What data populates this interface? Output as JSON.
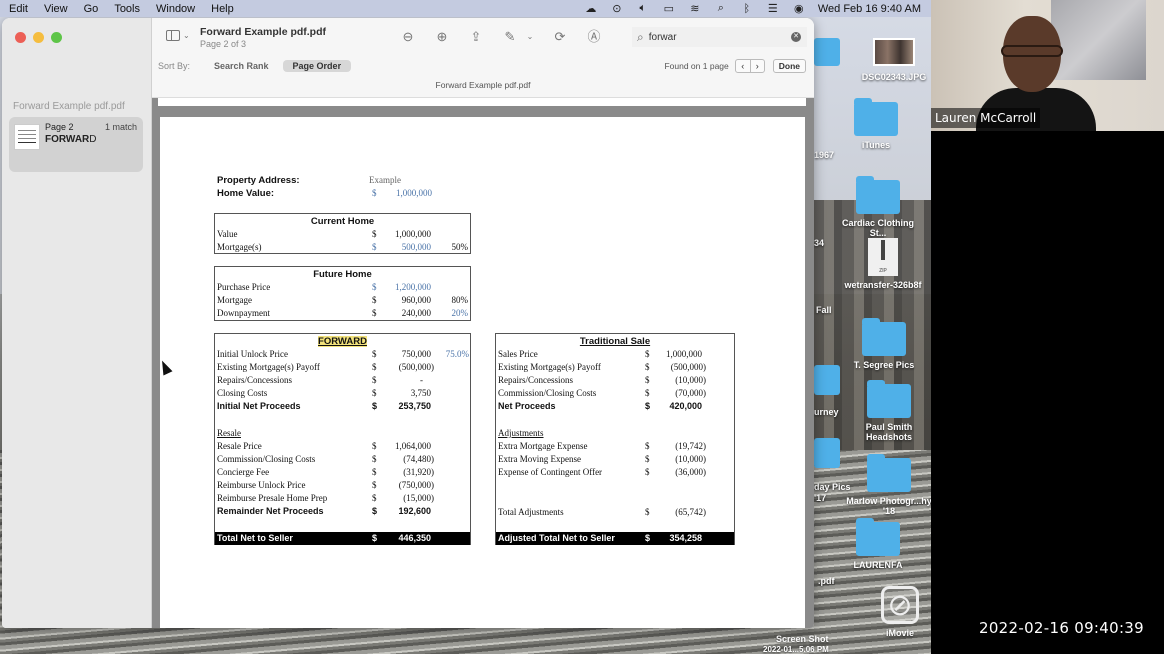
{
  "menubar": {
    "items": [
      "Edit",
      "View",
      "Go",
      "Tools",
      "Window",
      "Help"
    ],
    "status_icons": [
      "cloud-icon",
      "play-icon",
      "volume-icon",
      "battery-icon",
      "wifi-icon",
      "search-icon",
      "bluetooth-icon",
      "control-center-icon",
      "siri-icon"
    ],
    "clock": "Wed Feb 16  9:40 AM"
  },
  "window": {
    "title": "Forward Example pdf.pdf",
    "subtitle": "Page 2 of 3",
    "sidebar": {
      "doc_title": "Forward Example pdf.pdf",
      "result": {
        "page": "Page 2",
        "matches": "1 match",
        "snippet_match": "FORWAR",
        "snippet_rest": "D"
      }
    },
    "search": {
      "value": "forwar",
      "placeholder": "Search"
    },
    "sort": {
      "label": "Sort By:",
      "options": [
        "Search Rank",
        "Page Order"
      ],
      "selected": "Page Order"
    },
    "found_text": "Found on 1 page",
    "done_label": "Done",
    "filename_bar": "Forward Example pdf.pdf"
  },
  "document": {
    "property_address_label": "Property Address:",
    "property_address_value": "Example",
    "home_value_label": "Home Value:",
    "home_value_currency": "$",
    "home_value": "1,000,000",
    "current_home": {
      "title": "Current Home",
      "rows": [
        {
          "label": "Value",
          "cur": "$",
          "amount": "1,000,000",
          "pct": ""
        },
        {
          "label": "Mortgage(s)",
          "cur": "$",
          "amount": "500,000",
          "pct": "50%"
        }
      ]
    },
    "future_home": {
      "title": "Future Home",
      "rows": [
        {
          "label": "Purchase Price",
          "cur": "$",
          "amount": "1,200,000",
          "pct": ""
        },
        {
          "label": "Mortgage",
          "cur": "$",
          "amount": "960,000",
          "pct": "80%"
        },
        {
          "label": "Downpayment",
          "cur": "$",
          "amount": "240,000",
          "pct": "20%"
        }
      ]
    },
    "forward": {
      "title": "FORWARD",
      "rows": [
        {
          "label": "Initial Unlock Price",
          "cur": "$",
          "amount": "750,000",
          "pct": "75.0%"
        },
        {
          "label": "Existing Mortgage(s) Payoff",
          "cur": "$",
          "amount": "(500,000)",
          "pct": ""
        },
        {
          "label": "Repairs/Concessions",
          "cur": "$",
          "amount": "-",
          "pct": ""
        },
        {
          "label": "Closing Costs",
          "cur": "$",
          "amount": "3,750",
          "pct": ""
        }
      ],
      "initial_net": {
        "label": "Initial Net Proceeds",
        "cur": "$",
        "amount": "253,750"
      },
      "resale_heading": "Resale",
      "resale_rows": [
        {
          "label": "Resale Price",
          "cur": "$",
          "amount": "1,064,000"
        },
        {
          "label": "Commission/Closing Costs",
          "cur": "$",
          "amount": "(74,480)"
        },
        {
          "label": "Concierge Fee",
          "cur": "$",
          "amount": "(31,920)"
        },
        {
          "label": "Reimburse Unlock Price",
          "cur": "$",
          "amount": "(750,000)"
        },
        {
          "label": "Reimburse Presale Home Prep",
          "cur": "$",
          "amount": "(15,000)"
        }
      ],
      "remainder": {
        "label": "Remainder Net Proceeds",
        "cur": "$",
        "amount": "192,600"
      },
      "total": {
        "label": "Total Net to Seller",
        "cur": "$",
        "amount": "446,350"
      }
    },
    "traditional": {
      "title": "Traditional Sale",
      "rows": [
        {
          "label": "Sales Price",
          "cur": "$",
          "amount": "1,000,000"
        },
        {
          "label": "Existing Mortgage(s) Payoff",
          "cur": "$",
          "amount": "(500,000)"
        },
        {
          "label": "Repairs/Concessions",
          "cur": "$",
          "amount": "(10,000)"
        },
        {
          "label": "Commission/Closing Costs",
          "cur": "$",
          "amount": "(70,000)"
        }
      ],
      "net": {
        "label": "Net Proceeds",
        "cur": "$",
        "amount": "420,000"
      },
      "adjustments_heading": "Adjustments",
      "adjustment_rows": [
        {
          "label": "Extra Mortgage Expense",
          "cur": "$",
          "amount": "(19,742)"
        },
        {
          "label": "Extra Moving Expense",
          "cur": "$",
          "amount": "(10,000)"
        },
        {
          "label": "Expense of Contingent Offer",
          "cur": "$",
          "amount": "(36,000)"
        }
      ],
      "total_adjustments": {
        "label": "Total Adjustments",
        "cur": "$",
        "amount": "(65,742)"
      },
      "total": {
        "label": "Adjusted Total Net to Seller",
        "cur": "$",
        "amount": "354,258"
      }
    }
  },
  "desktop": {
    "icons": [
      {
        "name": "DSC02343.JPG",
        "type": "image"
      },
      {
        "name": "iTunes",
        "type": "folder"
      },
      {
        "name": "Cardiac Clothing St...",
        "type": "folder"
      },
      {
        "name": "wetransfer-326b8f",
        "type": "zip"
      },
      {
        "name": "T. Segree Pics",
        "type": "folder"
      },
      {
        "name": "Paul Smith Headshots",
        "type": "folder"
      },
      {
        "name": "Marlow Photogr...hy '18",
        "type": "folder"
      },
      {
        "name": "LAURENFA",
        "type": "folder"
      },
      {
        "name": "iMovie",
        "type": "app"
      }
    ],
    "partial_labels": [
      "1967",
      "34",
      "Fall",
      "urney",
      "day Pics",
      "'17",
      ".pdf",
      "Screen Shot",
      "2022-01...5.06 PM"
    ]
  },
  "video": {
    "participant_name": "Lauren McCarroll",
    "timestamp": "2022-02-16  09:40:39"
  }
}
